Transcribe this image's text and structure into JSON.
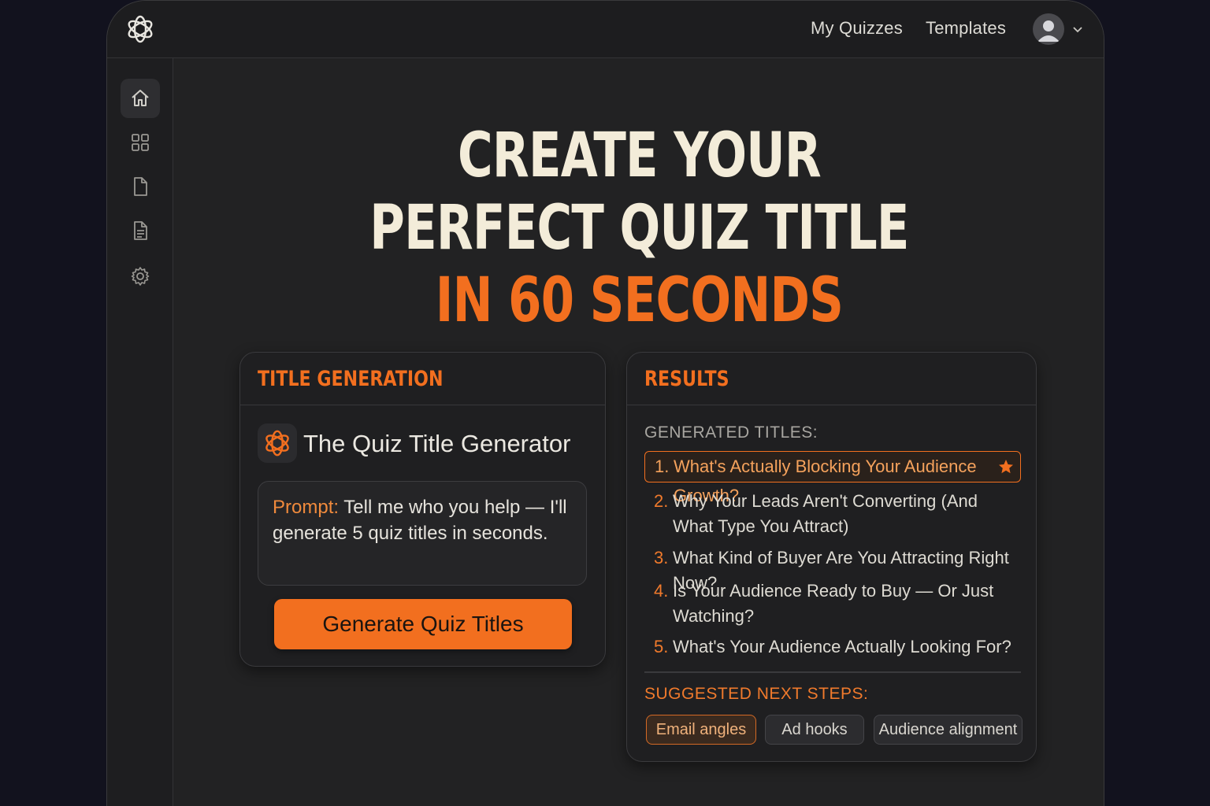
{
  "header": {
    "nav": [
      "My Quizzes",
      "Templates"
    ]
  },
  "sidebar": {
    "items": [
      "home-icon",
      "grid-icon",
      "file-icon",
      "document-icon",
      "gear-icon"
    ]
  },
  "hero": {
    "line1": "CREATE YOUR",
    "line2": "PERFECT QUIZ TITLE",
    "line3": "IN 60 SECONDS"
  },
  "generation": {
    "title": "TITLE GENERATION",
    "generator_name": "The Quiz Title Generator",
    "prompt_label": "Prompt:",
    "prompt_text": " Tell me who you help — I'll generate 5 quiz titles in seconds.",
    "button_label": "Generate Quiz Titles"
  },
  "results": {
    "title": "RESULTS",
    "generated_heading": "GENERATED TITLES:",
    "items": [
      {
        "num": "1.",
        "text": "What's Actually Blocking Your Audience Growth?"
      },
      {
        "num": "2.",
        "text": "Why Your Leads Aren't Converting (And What Type You Attract)"
      },
      {
        "num": "3.",
        "text": "What Kind of Buyer Are You Attracting Right Now?"
      },
      {
        "num": "4.",
        "text": "Is Your Audience Ready to Buy — Or Just Watching?"
      },
      {
        "num": "5.",
        "text": "What's Your Audience Actually Looking For?"
      }
    ],
    "next_heading": "SUGGESTED NEXT STEPS:",
    "chips": [
      "Email angles",
      "Ad hooks",
      "Audience alignment"
    ]
  },
  "colors": {
    "accent": "#f26f1f",
    "background": "#222223",
    "outer": "#12121e"
  }
}
